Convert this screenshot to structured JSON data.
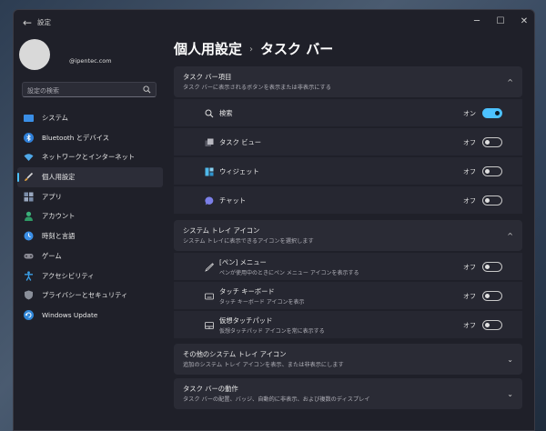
{
  "window": {
    "title": "設定",
    "controls": [
      "─",
      "☐",
      "✕"
    ]
  },
  "user": {
    "email": "@ipentec.com"
  },
  "search": {
    "placeholder": "設定の検索"
  },
  "sidebar": {
    "items": [
      {
        "label": "システム",
        "icon": "system-icon",
        "color": "#3a8ee6",
        "active": false
      },
      {
        "label": "Bluetooth とデバイス",
        "icon": "bluetooth-icon",
        "color": "#2f7fd8",
        "active": false
      },
      {
        "label": "ネットワークとインターネット",
        "icon": "network-icon",
        "color": "#4fa8e8",
        "active": false
      },
      {
        "label": "個人用設定",
        "icon": "brush-icon",
        "color": "#e0a040",
        "active": true
      },
      {
        "label": "アプリ",
        "icon": "apps-icon",
        "color": "#7a8ca8",
        "active": false
      },
      {
        "label": "アカウント",
        "icon": "account-icon",
        "color": "#3bb07a",
        "active": false
      },
      {
        "label": "時刻と言語",
        "icon": "clock-icon",
        "color": "#3a8ee6",
        "active": false
      },
      {
        "label": "ゲーム",
        "icon": "game-icon",
        "color": "#8a8a94",
        "active": false
      },
      {
        "label": "アクセシビリティ",
        "icon": "accessibility-icon",
        "color": "#3a9ee6",
        "active": false
      },
      {
        "label": "プライバシーとセキュリティ",
        "icon": "shield-icon",
        "color": "#8a8f9a",
        "active": false
      },
      {
        "label": "Windows Update",
        "icon": "update-icon",
        "color": "#2f86d8",
        "active": false
      }
    ]
  },
  "main": {
    "breadcrumb": {
      "parent": "個人用設定",
      "separator": "›",
      "current": "タスク バー"
    },
    "sections": [
      {
        "title": "タスク バー項目",
        "subtitle": "タスク バーに表示されるボタンを表示または非表示にする",
        "chevron": "^"
      },
      {
        "title": "システム トレイ アイコン",
        "subtitle": "システム トレイに表示できるアイコンを選択します",
        "chevron": "^"
      },
      {
        "title": "その他のシステム トレイ アイコン",
        "subtitle": "追加のシステム トレイ アイコンを表示、または非表示にします",
        "chevron": "⌄"
      },
      {
        "title": "タスク バーの動作",
        "subtitle": "タスク バーの配置、バッジ、自動的に非表示、および複数のディスプレイ",
        "chevron": "⌄"
      }
    ],
    "taskbar_items": [
      {
        "label": "検索",
        "state": "オン",
        "on": true
      },
      {
        "label": "タスク ビュー",
        "state": "オフ",
        "on": false
      },
      {
        "label": "ウィジェット",
        "state": "オフ",
        "on": false
      },
      {
        "label": "チャット",
        "state": "オフ",
        "on": false
      }
    ],
    "tray_icons": [
      {
        "label": "[ペン] メニュー",
        "sub": "ペンが使用中のときにペン メニュー アイコンを表示する",
        "state": "オフ",
        "on": false
      },
      {
        "label": "タッチ キーボード",
        "sub": "タッチ キーボード アイコンを表示",
        "state": "オフ",
        "on": false
      },
      {
        "label": "仮想タッチパッド",
        "sub": "仮想タッチパッド アイコンを常に表示する",
        "state": "オフ",
        "on": false
      }
    ]
  },
  "colors": {
    "accent": "#4cc2ff",
    "window_bg": "#1f2029",
    "card_bg": "#262731"
  }
}
